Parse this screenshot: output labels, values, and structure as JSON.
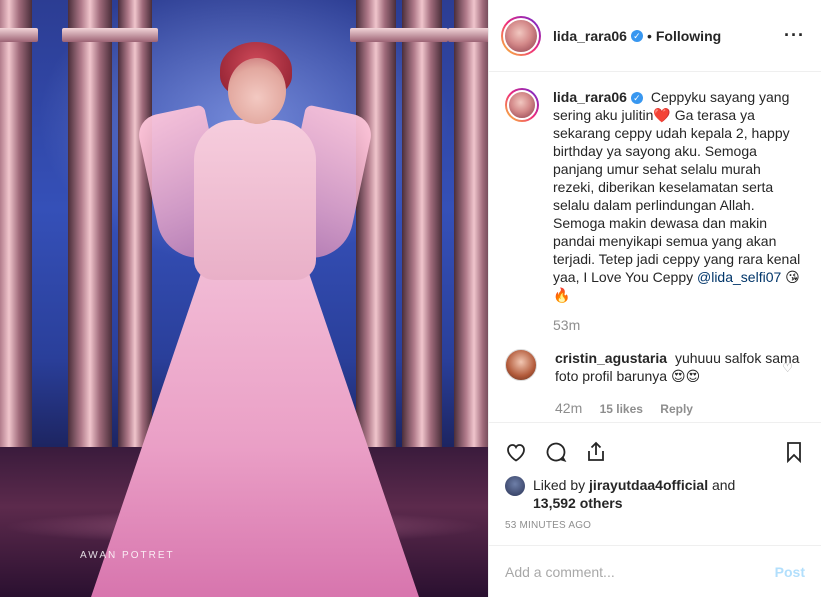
{
  "photo": {
    "watermark": "AWAN POTRET"
  },
  "header": {
    "username": "lida_rara06",
    "separator": "•",
    "follow_status": "Following",
    "more_icon": "more-horizontal-icon"
  },
  "caption": {
    "username": "lida_rara06",
    "text_line1": "Ceppyku sayang yang sering aku julitin",
    "emoji_heart": "❤️",
    "text_body": "Ga terasa ya sekarang ceppy udah kepala 2, happy birthday ya sayong aku. Semoga panjang umur sehat selalu murah rezeki, diberikan keselamatan serta selalu dalam perlindungan Allah. Semoga makin dewasa dan makin pandai menyikapi semua yang akan terjadi. Tetep jadi ceppy yang rara kenal yaa, I Love You Ceppy",
    "mention": "@lida_selfi07",
    "emoji_end": "😘🔥",
    "time": "53m"
  },
  "comment": {
    "username": "cristin_agustaria",
    "text": "yuhuuu salfok sama foto profil barunya",
    "emoji": "😍😍",
    "time": "42m",
    "likes": "15 likes",
    "reply_label": "Reply"
  },
  "actions": {
    "icons": [
      "heart-icon",
      "comment-icon",
      "share-icon",
      "bookmark-icon"
    ]
  },
  "likes": {
    "prefix": "Liked by",
    "user": "jirayutdaa4official",
    "connector": "and",
    "others": "13,592 others"
  },
  "posted_ago": "53 MINUTES AGO",
  "add_comment": {
    "placeholder": "Add a comment...",
    "post_label": "Post"
  },
  "colors": {
    "verified_blue": "#3897f0",
    "post_disabled": "#b2dffc",
    "meta_gray": "#8e8e8e"
  }
}
